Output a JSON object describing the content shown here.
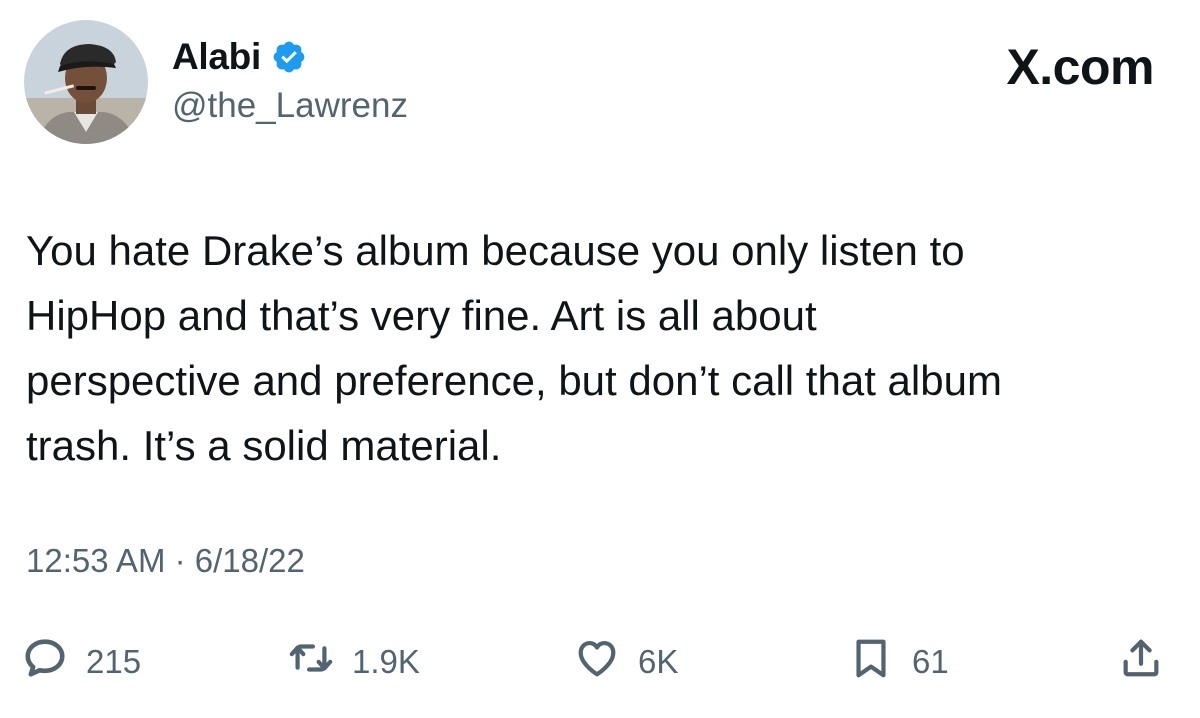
{
  "brand": "X.com",
  "author": {
    "display_name": "Alabi",
    "handle": "@the_Lawrenz",
    "verified_color": "#1d9bf0"
  },
  "tweet": {
    "text": "You hate Drake’s album because you only listen to\nHipHop and that’s very fine. Art is all about\nperspective and preference, but don’t call that album\ntrash. It’s a solid material.",
    "timestamp": "12:53 AM · 6/18/22"
  },
  "actions": {
    "replies": "215",
    "retweets": "1.9K",
    "likes": "6K",
    "bookmarks": "61"
  },
  "icons": [
    "verified-badge-icon",
    "reply-icon",
    "retweet-icon",
    "like-icon",
    "bookmark-icon",
    "share-icon"
  ],
  "colors": {
    "text": "#0f1419",
    "secondary": "#536471",
    "background": "#ffffff"
  }
}
